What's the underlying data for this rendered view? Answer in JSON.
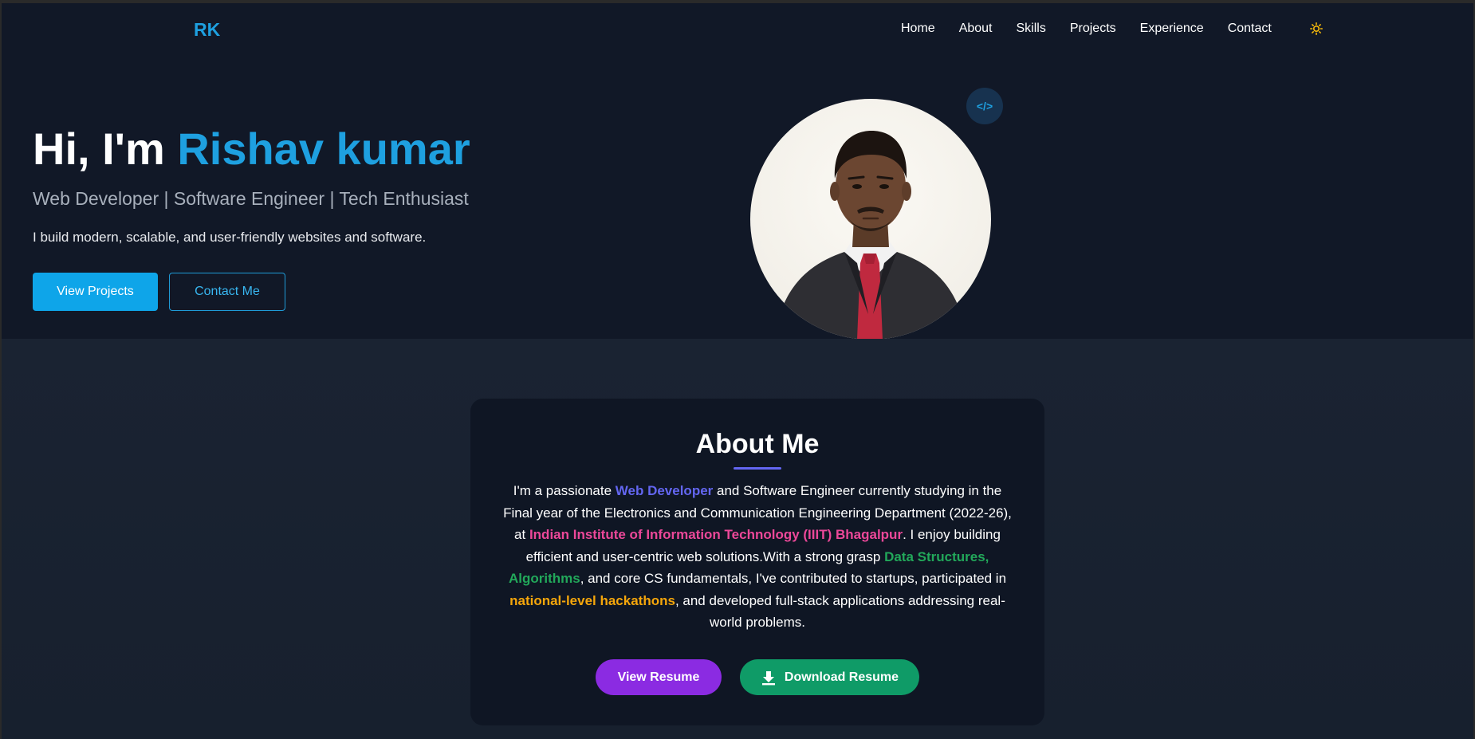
{
  "nav": {
    "logo": "RK",
    "links": [
      "Home",
      "About",
      "Skills",
      "Projects",
      "Experience",
      "Contact"
    ],
    "theme_icon": "sun-icon"
  },
  "hero": {
    "greeting": "Hi, I'm",
    "name": "Rishav kumar",
    "subtitle": "Web Developer | Software Engineer | Tech Enthusiast",
    "description": "I build modern, scalable, and user-friendly websites and software.",
    "primary_button": "View Projects",
    "secondary_button": "Contact Me",
    "badge_icon": "code-icon",
    "badge_text": "</>"
  },
  "about": {
    "title": "About Me",
    "text": {
      "p1": "I'm a passionate ",
      "h1": "Web Developer",
      "p2": " and Software Engineer currently studying in the Final year of the Electronics and Communication Engineering Department (2022-26), at ",
      "h2": "Indian Institute of Information Technology (IIIT) Bhagalpur",
      "p3": ". I enjoy building efficient and user-centric web solutions.With a strong grasp ",
      "h3": "Data Structures, Algorithms",
      "p4": ", and core CS fundamentals, I've contributed to startups, participated in ",
      "h4": "national-level hackathons",
      "p5": ", and developed full-stack applications addressing real-world problems."
    },
    "view_resume": "View Resume",
    "download_resume": "Download Resume",
    "download_icon": "download-icon"
  },
  "colors": {
    "accent": "#1ea0e0",
    "background": "#111827",
    "card": "#0f1624",
    "resume_button": "#8b2be2",
    "download_button": "#0f9b67"
  }
}
